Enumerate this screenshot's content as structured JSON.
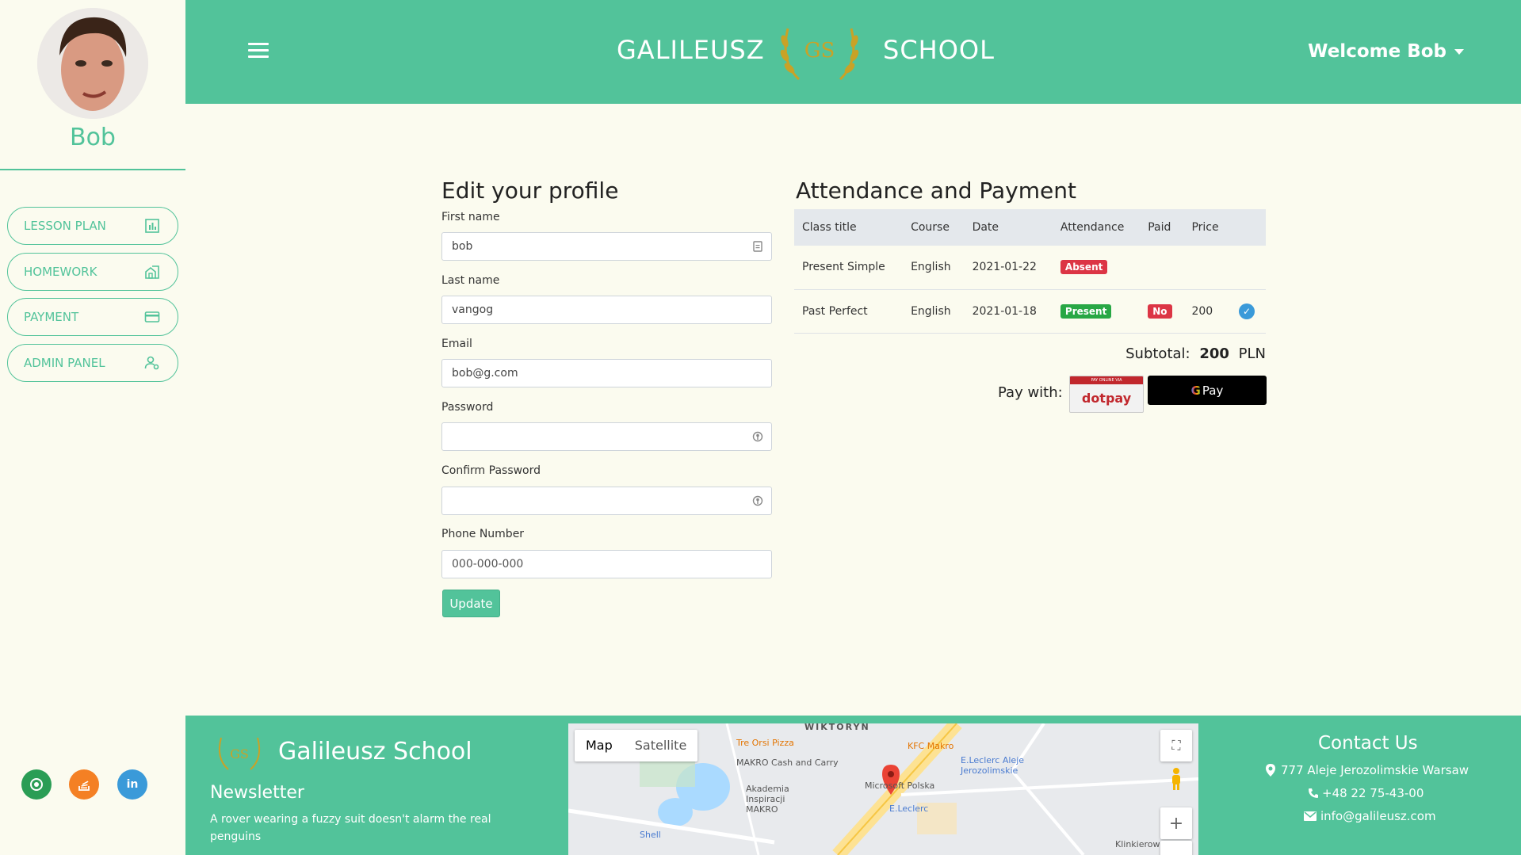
{
  "sidebar": {
    "username": "Bob",
    "items": [
      {
        "label": "LESSON PLAN",
        "icon": "chart-icon"
      },
      {
        "label": "HOMEWORK",
        "icon": "home-work-icon"
      },
      {
        "label": "PAYMENT",
        "icon": "credit-card-icon"
      },
      {
        "label": "ADMIN PANEL",
        "icon": "admin-user-icon"
      }
    ],
    "social": [
      {
        "name": "github-icon",
        "glyph": "◉",
        "color": "#2a9d55"
      },
      {
        "name": "stackoverflow-icon",
        "glyph": "≡",
        "color": "#f48024"
      },
      {
        "name": "linkedin-icon",
        "glyph": "in",
        "color": "#3a9ad9"
      }
    ]
  },
  "header": {
    "brand_left": "GALILEUSZ",
    "brand_logo": "GS",
    "brand_right": "SCHOOL",
    "welcome": "Welcome Bob"
  },
  "profile": {
    "title": "Edit your profile",
    "fields": [
      {
        "label": "First name",
        "value": "bob",
        "placeholder": ""
      },
      {
        "label": "Last name",
        "value": "vangog",
        "placeholder": ""
      },
      {
        "label": "Email",
        "value": "bob@g.com",
        "placeholder": ""
      },
      {
        "label": "Password",
        "value": "",
        "placeholder": ""
      },
      {
        "label": "Confirm Password",
        "value": "",
        "placeholder": ""
      },
      {
        "label": "Phone Number",
        "value": "",
        "placeholder": "000-000-000"
      }
    ],
    "update_label": "Update"
  },
  "attendance": {
    "title": "Attendance and Payment",
    "columns": [
      "Class title",
      "Course",
      "Date",
      "Attendance",
      "Paid",
      "Price"
    ],
    "rows": [
      {
        "class_title": "Present Simple",
        "course": "English",
        "date": "2021-01-22",
        "attendance": "Absent",
        "paid": "",
        "price": ""
      },
      {
        "class_title": "Past Perfect",
        "course": "English",
        "date": "2021-01-18",
        "attendance": "Present",
        "paid": "No",
        "price": "200"
      }
    ],
    "subtotal_label": "Subtotal:",
    "subtotal_value": "200",
    "currency": "PLN",
    "pay_with": "Pay with:",
    "dotpay_top": "PAY ONLINE VIA",
    "dotpay_label": "dotpay",
    "gpay_label": "Pay"
  },
  "footer": {
    "logo": "GS",
    "name": "Galileusz School",
    "newsletter_title": "Newsletter",
    "newsletter_text": "A rover wearing a fuzzy suit doesn't alarm the real penguins",
    "map": {
      "tab_map": "Map",
      "tab_satellite": "Satellite",
      "labels": [
        "WIKTORYN",
        "Tre Orsi Pizza",
        "KFC Makro",
        "MAKRO Cash and Carry",
        "E.Leclerc Aleje Jerozolimskie",
        "Akademia Inspiracji MAKRO",
        "Microsoft Polska",
        "E.Leclerc",
        "Shell",
        "Klinkierowa"
      ]
    },
    "contact_title": "Contact Us",
    "address": "777 Aleje Jerozolimskie Warsaw",
    "phone": "+48 22 75-43-00",
    "email": "info@galileusz.com"
  }
}
